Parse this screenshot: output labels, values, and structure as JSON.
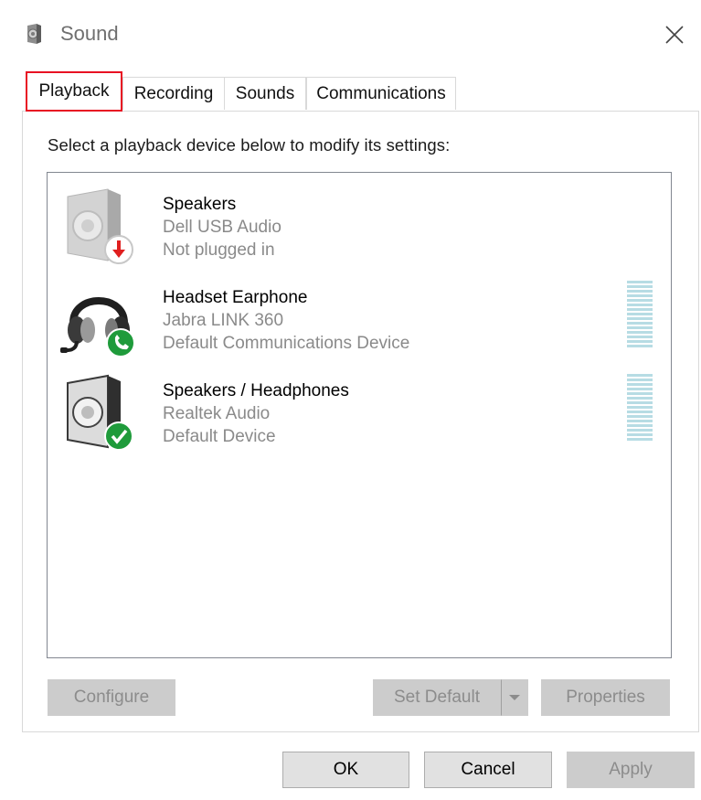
{
  "window": {
    "title": "Sound",
    "close_icon": "close-icon"
  },
  "tabs": [
    {
      "label": "Playback",
      "selected": true
    },
    {
      "label": "Recording",
      "selected": false
    },
    {
      "label": "Sounds",
      "selected": false
    },
    {
      "label": "Communications",
      "selected": false
    }
  ],
  "panel": {
    "instruction": "Select a playback device below to modify its settings:"
  },
  "devices": [
    {
      "name": "Speakers",
      "driver": "Dell USB Audio",
      "status": "Not plugged in",
      "icon": "speaker-icon",
      "badge": "red-down-arrow-badge"
    },
    {
      "name": "Headset Earphone",
      "driver": "Jabra LINK 360",
      "status": "Default Communications Device",
      "icon": "headset-icon",
      "badge": "green-phone-badge"
    },
    {
      "name": "Speakers / Headphones",
      "driver": "Realtek Audio",
      "status": "Default Device",
      "icon": "speaker-icon",
      "badge": "green-check-badge"
    }
  ],
  "buttons": {
    "configure": "Configure",
    "set_default": "Set Default",
    "properties": "Properties",
    "ok": "OK",
    "cancel": "Cancel",
    "apply": "Apply"
  },
  "colors": {
    "highlight_border": "#e81123",
    "meter": "#b7dce4",
    "badge_green": "#1f9b3b",
    "badge_red": "#e01f1f"
  }
}
